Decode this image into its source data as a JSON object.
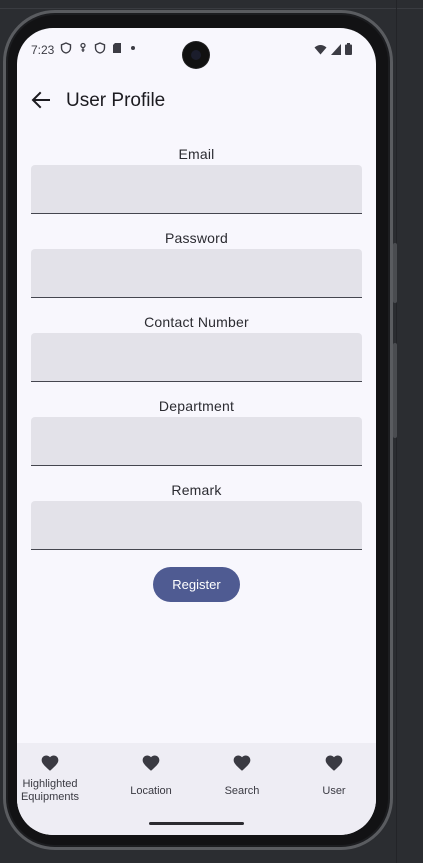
{
  "status_bar": {
    "time": "7:23",
    "left_icons": [
      "shield-icon",
      "vpn-key-icon",
      "shield-icon",
      "sd-card-icon"
    ],
    "right_icons": [
      "wifi-icon",
      "cellular-signal-icon",
      "battery-icon"
    ]
  },
  "app_bar": {
    "title": "User Profile",
    "back_icon": "arrow-back-icon"
  },
  "form": {
    "fields": [
      {
        "label": "Email",
        "value": "",
        "placeholder": ""
      },
      {
        "label": "Password",
        "value": "",
        "placeholder": ""
      },
      {
        "label": "Contact Number",
        "value": "",
        "placeholder": ""
      },
      {
        "label": "Department",
        "value": "",
        "placeholder": ""
      },
      {
        "label": "Remark",
        "value": "",
        "placeholder": ""
      }
    ],
    "register_label": "Register"
  },
  "bottom_nav": {
    "items": [
      {
        "label": "Highlighted Equipments",
        "icon": "heart-icon"
      },
      {
        "label": "Location",
        "icon": "heart-icon"
      },
      {
        "label": "Search",
        "icon": "heart-icon"
      },
      {
        "label": "User",
        "icon": "heart-icon"
      }
    ]
  },
  "colors": {
    "screen_bg": "#f8f7fd",
    "input_bg": "#e3e2e9",
    "primary": "#4f5b92",
    "nav_bg": "#eeedf4",
    "frame_bg": "#2b2d31"
  }
}
